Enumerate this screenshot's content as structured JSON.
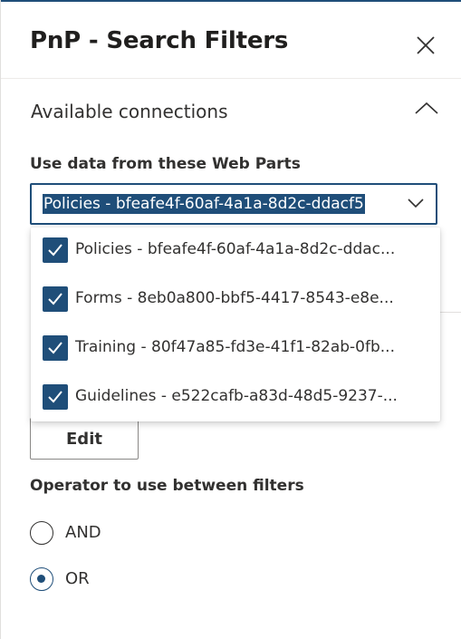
{
  "panel": {
    "title": "PnP - Search Filters",
    "close_icon": "close-icon"
  },
  "connections": {
    "section_title": "Available connections",
    "expanded": true,
    "field_label": "Use data from these Web Parts",
    "selected_value": "Policies - bfeafe4f-60af-4a1a-8d2c-ddacf5",
    "options": [
      {
        "label": "Policies - bfeafe4f-60af-4a1a-8d2c-ddac...",
        "checked": true
      },
      {
        "label": "Forms - 8eb0a800-bbf5-4417-8543-e8e...",
        "checked": true
      },
      {
        "label": "Training - 80f47a85-fd3e-41f1-82ab-0fb...",
        "checked": true
      },
      {
        "label": "Guidelines - e522cafb-a83d-48d5-9237-...",
        "checked": true
      }
    ]
  },
  "filters": {
    "edit_label": "Edit",
    "operator_label": "Operator to use between filters",
    "operators": [
      {
        "label": "AND",
        "selected": false
      },
      {
        "label": "OR",
        "selected": true
      }
    ]
  },
  "colors": {
    "accent": "#1f4e79",
    "text": "#323130"
  }
}
